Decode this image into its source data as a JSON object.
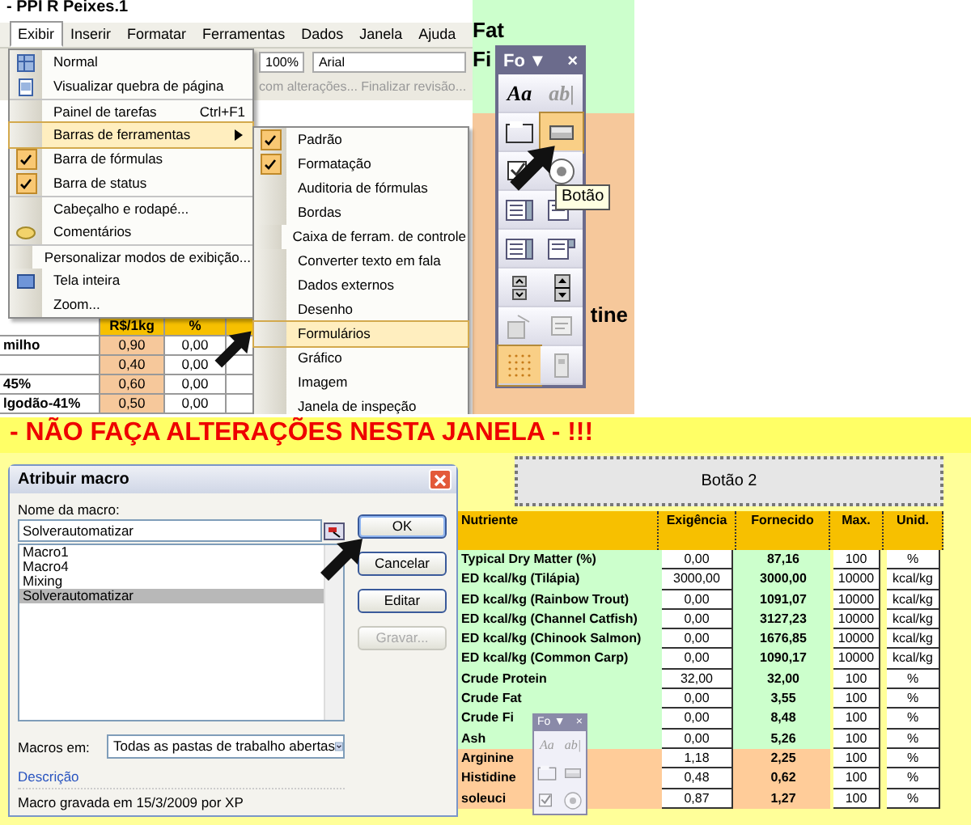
{
  "top": {
    "title": "- PPI R Peixes.1",
    "menubar": [
      {
        "label": "Exibir",
        "selected": true
      },
      {
        "label": "Inserir",
        "selected": false
      },
      {
        "label": "Formatar",
        "selected": false
      },
      {
        "label": "Ferramentas",
        "selected": false
      },
      {
        "label": "Dados",
        "selected": false
      },
      {
        "label": "Janela",
        "selected": false
      },
      {
        "label": "Ajuda",
        "selected": false
      }
    ],
    "toolbar": {
      "zoom": "100%",
      "font": "Arial",
      "review": "com alterações... Finalizar revisão..."
    },
    "sheet": {
      "columns": [
        "R$/1kg",
        "%"
      ],
      "rows": [
        {
          "label": "milho",
          "price": "0,90",
          "pct": "0,00"
        },
        {
          "label": "",
          "price": "0,40",
          "pct": "0,00"
        },
        {
          "label": "45%",
          "price": "0,60",
          "pct": "0,00"
        },
        {
          "label": "lgodão-41%",
          "price": "0,50",
          "pct": "0,00"
        }
      ]
    },
    "side_texts": {
      "upper": [
        "Fat",
        "Fi"
      ],
      "lower": "tine"
    },
    "view_menu": [
      {
        "label": "Normal",
        "kind": "sheet",
        "checked": false,
        "selected": false,
        "divider": false
      },
      {
        "label": "Visualizar quebra de página",
        "kind": "page",
        "checked": false,
        "selected": false,
        "divider": false
      },
      {
        "label": "Painel de tarefas",
        "shortcut": "Ctrl+F1",
        "kind": "plain",
        "checked": false,
        "selected": false,
        "divider": true
      },
      {
        "label": "Barras de ferramentas",
        "kind": "plain",
        "checked": false,
        "selected": true,
        "submenu": true,
        "divider": false
      },
      {
        "label": "Barra de fórmulas",
        "kind": "plain",
        "checked": true,
        "selected": false,
        "divider": false
      },
      {
        "label": "Barra de status",
        "kind": "plain",
        "checked": true,
        "selected": false,
        "divider": false
      },
      {
        "label": "Cabeçalho e rodapé...",
        "kind": "plain",
        "checked": false,
        "selected": false,
        "divider": true
      },
      {
        "label": "Comentários",
        "kind": "note",
        "checked": false,
        "selected": false,
        "divider": false
      },
      {
        "label": "Personalizar modos de exibição...",
        "kind": "plain",
        "checked": false,
        "selected": false,
        "divider": true
      },
      {
        "label": "Tela inteira",
        "kind": "screen",
        "checked": false,
        "selected": false,
        "divider": false
      },
      {
        "label": "Zoom...",
        "kind": "plain",
        "checked": false,
        "selected": false,
        "divider": false
      }
    ],
    "toolbars_menu": [
      {
        "label": "Padrão",
        "checked": true,
        "selected": false
      },
      {
        "label": "Formatação",
        "checked": true,
        "selected": false
      },
      {
        "label": "Auditoria de fórmulas",
        "checked": false,
        "selected": false
      },
      {
        "label": "Bordas",
        "checked": false,
        "selected": false
      },
      {
        "label": "Caixa de ferram. de controle",
        "checked": false,
        "selected": false
      },
      {
        "label": "Converter texto em fala",
        "checked": false,
        "selected": false
      },
      {
        "label": "Dados externos",
        "checked": false,
        "selected": false
      },
      {
        "label": "Desenho",
        "checked": false,
        "selected": false
      },
      {
        "label": "Formulários",
        "checked": false,
        "selected": true
      },
      {
        "label": "Gráfico",
        "checked": false,
        "selected": false
      },
      {
        "label": "Imagem",
        "checked": false,
        "selected": false
      },
      {
        "label": "Janela de inspeção",
        "checked": false,
        "selected": false
      }
    ],
    "forms_toolbar": {
      "title": "Fo",
      "menu_glyph": "▼",
      "close_glyph": "×",
      "tooltip": "Botão",
      "tools": [
        {
          "kind": "text",
          "glyph": "Aa",
          "selected": false
        },
        {
          "kind": "text",
          "glyph": "ab|",
          "selected": false
        },
        {
          "kind": "group",
          "selected": false
        },
        {
          "kind": "button",
          "selected": true
        },
        {
          "kind": "checkbox",
          "selected": false
        },
        {
          "kind": "radio",
          "selected": false
        },
        {
          "kind": "list",
          "selected": false
        },
        {
          "kind": "combo",
          "selected": false
        },
        {
          "kind": "list",
          "selected": false
        },
        {
          "kind": "combo",
          "selected": false
        },
        {
          "kind": "spinner",
          "selected": false
        },
        {
          "kind": "scroll",
          "selected": false
        },
        {
          "kind": "properties",
          "selected": false
        },
        {
          "kind": "code",
          "selected": false
        },
        {
          "kind": "grid",
          "selected": true
        },
        {
          "kind": "run",
          "selected": false
        }
      ]
    }
  },
  "banner": "- NÃO FAÇA ALTERAÇÕES NESTA JANELA - !!!",
  "dialog": {
    "title": "Atribuir macro",
    "name_label": "Nome da macro:",
    "name_value": "Solverautomatizar",
    "macros": [
      {
        "label": "Macro1",
        "selected": false
      },
      {
        "label": "Macro4",
        "selected": false
      },
      {
        "label": "Mixing",
        "selected": false
      },
      {
        "label": "Solverautomatizar",
        "selected": true
      }
    ],
    "buttons": [
      {
        "label": "OK",
        "disabled": false,
        "focused": true
      },
      {
        "label": "Cancelar",
        "disabled": false,
        "focused": false
      },
      {
        "label": "Editar",
        "disabled": false,
        "focused": false
      },
      {
        "label": "Gravar...",
        "disabled": true,
        "focused": false
      }
    ],
    "macros_in_label": "Macros em:",
    "macros_in_value": "Todas as pastas de trabalho abertas",
    "description_label": "Descrição",
    "description": "Macro gravada em 15/3/2009 por XP"
  },
  "sheet": {
    "button": "Botão 2",
    "columns": [
      "Nutriente",
      "Exigência",
      "Fornecido",
      "Max.",
      "Unid."
    ],
    "rows": [
      {
        "name": "Typical Dry Matter (%)",
        "req": "0,00",
        "supplied": "87,16",
        "max": "100",
        "unit": "%",
        "color": "#ccffcc"
      },
      {
        "name": "ED kcal/kg (Tilápia)",
        "req": "3000,00",
        "supplied": "3000,00",
        "max": "10000",
        "unit": "kcal/kg",
        "color": "#ccffcc"
      },
      {
        "name": "ED kcal/kg (Rainbow Trout)",
        "req": "0,00",
        "supplied": "1091,07",
        "max": "10000",
        "unit": "kcal/kg",
        "color": "#ccffcc"
      },
      {
        "name": "ED kcal/kg (Channel Catfish)",
        "req": "0,00",
        "supplied": "3127,23",
        "max": "10000",
        "unit": "kcal/kg",
        "color": "#ccffcc"
      },
      {
        "name": "ED kcal/kg (Chinook Salmon)",
        "req": "0,00",
        "supplied": "1676,85",
        "max": "10000",
        "unit": "kcal/kg",
        "color": "#ccffcc"
      },
      {
        "name": "ED kcal/kg (Common Carp)",
        "req": "0,00",
        "supplied": "1090,17",
        "max": "10000",
        "unit": "kcal/kg",
        "color": "#ccffcc"
      },
      {
        "name": "Crude Protein",
        "req": "32,00",
        "supplied": "32,00",
        "max": "100",
        "unit": "%",
        "color": "#ccffcc"
      },
      {
        "name": "Crude Fat",
        "req": "0,00",
        "supplied": "3,55",
        "max": "100",
        "unit": "%",
        "color": "#ccffcc"
      },
      {
        "name": "Crude Fi",
        "req": "0,00",
        "supplied": "8,48",
        "max": "100",
        "unit": "%",
        "color": "#ccffcc"
      },
      {
        "name": "Ash",
        "req": "0,00",
        "supplied": "5,26",
        "max": "100",
        "unit": "%",
        "color": "#ccffcc"
      },
      {
        "name": "Arginine",
        "req": "1,18",
        "supplied": "2,25",
        "max": "100",
        "unit": "%",
        "color": "#ffcc99"
      },
      {
        "name": "Histidine",
        "req": "0,48",
        "supplied": "0,62",
        "max": "100",
        "unit": "%",
        "color": "#ffcc99"
      },
      {
        "name": "soleuci",
        "req": "0,87",
        "supplied": "1,27",
        "max": "100",
        "unit": "%",
        "color": "#ffcc99"
      }
    ]
  },
  "mini_toolbar": {
    "title": "Fo",
    "menu_glyph": "▼",
    "close_glyph": "×",
    "tools": [
      {
        "kind": "text",
        "glyph": "Aa"
      },
      {
        "kind": "text",
        "glyph": "ab|"
      },
      {
        "kind": "group"
      },
      {
        "kind": "button"
      },
      {
        "kind": "checkbox"
      },
      {
        "kind": "radio"
      }
    ]
  }
}
